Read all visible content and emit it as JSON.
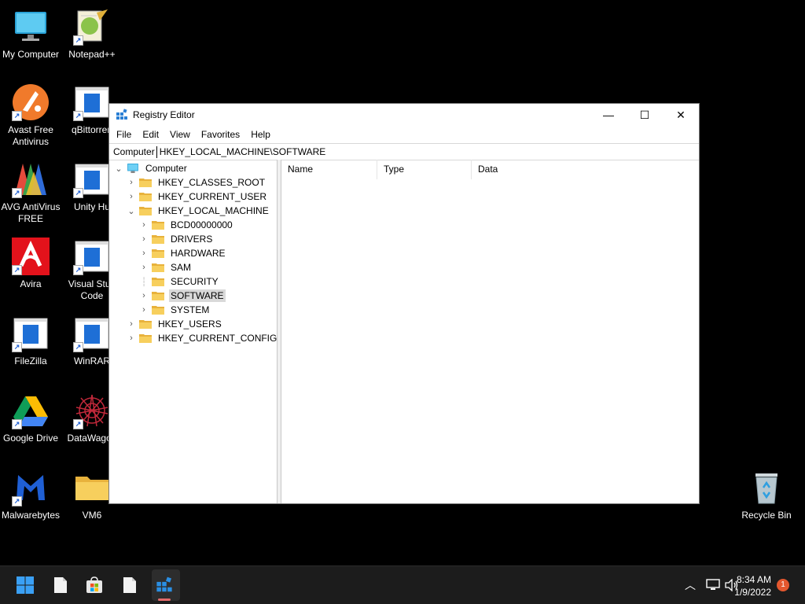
{
  "desktop": {
    "icons": [
      {
        "name": "my-computer",
        "label": "My Computer"
      },
      {
        "name": "notepad-plus-plus",
        "label": "Notepad++"
      },
      {
        "name": "avast",
        "label": "Avast Free Antivirus"
      },
      {
        "name": "qbittorrent",
        "label": "qBittorren"
      },
      {
        "name": "avg",
        "label": "AVG AntiVirus FREE"
      },
      {
        "name": "unity-hub",
        "label": "Unity Hu"
      },
      {
        "name": "avira",
        "label": "Avira"
      },
      {
        "name": "vscode",
        "label": "Visual Stud Code"
      },
      {
        "name": "filezilla",
        "label": "FileZilla"
      },
      {
        "name": "winrar",
        "label": "WinRAR"
      },
      {
        "name": "google-drive",
        "label": "Google Drive"
      },
      {
        "name": "datawagon",
        "label": "DataWagon"
      },
      {
        "name": "malwarebytes",
        "label": "Malwarebytes"
      },
      {
        "name": "vm6",
        "label": "VM6"
      },
      {
        "name": "recycle-bin",
        "label": "Recycle Bin"
      }
    ]
  },
  "window": {
    "title": "Registry Editor",
    "controls": {
      "minimize": "—",
      "maximize": "☐",
      "close": "✕"
    },
    "menu": [
      "File",
      "Edit",
      "View",
      "Favorites",
      "Help"
    ],
    "address": {
      "root": "Computer",
      "path": "HKEY_LOCAL_MACHINE\\SOFTWARE"
    },
    "tree": {
      "root": "Computer",
      "hives": [
        {
          "label": "HKEY_CLASSES_ROOT",
          "expanded": false
        },
        {
          "label": "HKEY_CURRENT_USER",
          "expanded": false
        },
        {
          "label": "HKEY_LOCAL_MACHINE",
          "expanded": true
        },
        {
          "label": "HKEY_USERS",
          "expanded": false
        },
        {
          "label": "HKEY_CURRENT_CONFIG",
          "expanded": false
        }
      ],
      "hklm_children": [
        {
          "label": "BCD00000000",
          "has_children": true
        },
        {
          "label": "DRIVERS",
          "has_children": true
        },
        {
          "label": "HARDWARE",
          "has_children": true
        },
        {
          "label": "SAM",
          "has_children": true
        },
        {
          "label": "SECURITY",
          "has_children": false
        },
        {
          "label": "SOFTWARE",
          "has_children": true,
          "selected": true
        },
        {
          "label": "SYSTEM",
          "has_children": true
        }
      ]
    },
    "list_columns": [
      "Name",
      "Type",
      "Data"
    ]
  },
  "taskbar": {
    "time": "8:34 AM",
    "date": "1/9/2022",
    "notification_count": "1",
    "tray_icons": [
      "chevron-up-icon",
      "network-icon",
      "volume-icon"
    ]
  },
  "colors": {
    "desktop_bg": "#000000",
    "taskbar_bg": "#1c1c1c",
    "folder": "#f2c55c",
    "selection": "#d9d9d9",
    "active_indicator": "#e36b6b",
    "badge": "#e4572e"
  }
}
